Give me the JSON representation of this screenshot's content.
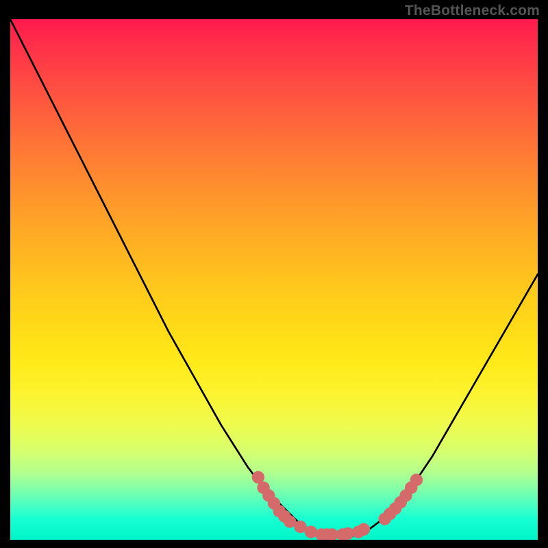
{
  "watermark": "TheBottleneck.com",
  "chart_data": {
    "type": "line",
    "title": "",
    "xlabel": "",
    "ylabel": "",
    "xlim": [
      0,
      100
    ],
    "ylim": [
      0,
      100
    ],
    "gradient_stops": [
      {
        "pct": 0,
        "color": "#ff1a4d"
      },
      {
        "pct": 50,
        "color": "#ffcc1c"
      },
      {
        "pct": 80,
        "color": "#efff55"
      },
      {
        "pct": 100,
        "color": "#00f5c8"
      }
    ],
    "series": [
      {
        "name": "bottleneck-curve",
        "x": [
          0,
          5,
          10,
          15,
          20,
          25,
          30,
          35,
          40,
          45,
          48,
          50,
          55,
          58,
          60,
          62,
          64,
          66,
          68,
          72,
          76,
          80,
          84,
          88,
          92,
          96,
          100
        ],
        "y": [
          100,
          90,
          80,
          70,
          60,
          50,
          40,
          31,
          22,
          14,
          10,
          8,
          3,
          1,
          0.5,
          0.5,
          0.5,
          1,
          2,
          5,
          10,
          16,
          23,
          30,
          37,
          44,
          51
        ]
      }
    ],
    "markers": {
      "color": "#d46a6a",
      "radius": 1.2,
      "points": [
        {
          "x": 47,
          "y": 12
        },
        {
          "x": 48,
          "y": 10
        },
        {
          "x": 49,
          "y": 8.5
        },
        {
          "x": 50,
          "y": 7
        },
        {
          "x": 51,
          "y": 5.5
        },
        {
          "x": 52,
          "y": 4.5
        },
        {
          "x": 53,
          "y": 3.5
        },
        {
          "x": 55,
          "y": 2.5
        },
        {
          "x": 57,
          "y": 1.5
        },
        {
          "x": 59,
          "y": 1
        },
        {
          "x": 60,
          "y": 1
        },
        {
          "x": 61,
          "y": 1
        },
        {
          "x": 63,
          "y": 1
        },
        {
          "x": 64,
          "y": 1.2
        },
        {
          "x": 66,
          "y": 1.5
        },
        {
          "x": 67,
          "y": 2
        },
        {
          "x": 71,
          "y": 4
        },
        {
          "x": 72,
          "y": 5
        },
        {
          "x": 73,
          "y": 6
        },
        {
          "x": 74,
          "y": 7.2
        },
        {
          "x": 75,
          "y": 8.5
        },
        {
          "x": 76,
          "y": 10
        },
        {
          "x": 77,
          "y": 11.5
        }
      ]
    }
  }
}
